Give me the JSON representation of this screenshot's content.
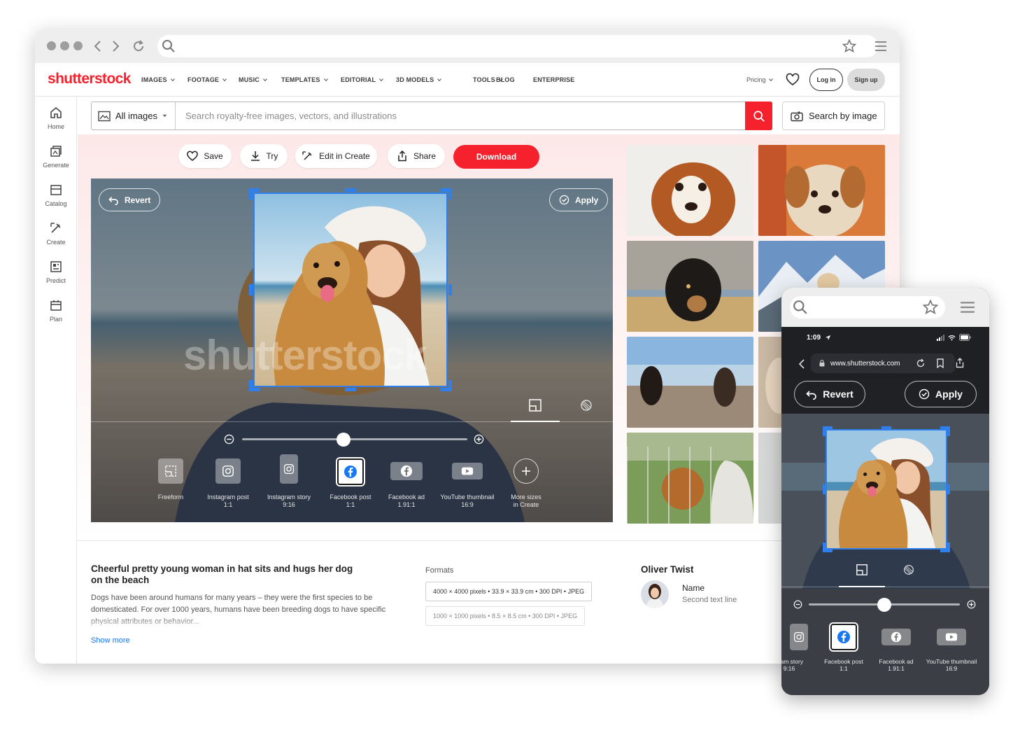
{
  "brand": {
    "logo": "shutterstock",
    "accent": "#f5222d",
    "selection": "#2f80ed"
  },
  "nav": {
    "items": [
      {
        "label": "IMAGES",
        "dropdown": true
      },
      {
        "label": "FOOTAGE",
        "dropdown": true
      },
      {
        "label": "MUSIC",
        "dropdown": true
      },
      {
        "label": "TEMPLATES",
        "dropdown": true
      },
      {
        "label": "EDITORIAL",
        "dropdown": true
      },
      {
        "label": "3D MODELS",
        "dropdown": true
      },
      {
        "label": "TOOLS",
        "dropdown": true
      },
      {
        "label": "BLOG",
        "dropdown": false
      },
      {
        "label": "ENTERPRISE",
        "dropdown": false
      }
    ],
    "pricing": "Pricing",
    "login": "Log in",
    "signup": "Sign up"
  },
  "sidebar": {
    "items": [
      {
        "label": "Home",
        "icon": "home-icon"
      },
      {
        "label": "Generate",
        "icon": "generate-icon"
      },
      {
        "label": "Catalog",
        "icon": "catalog-icon"
      },
      {
        "label": "Create",
        "icon": "create-icon"
      },
      {
        "label": "Predict",
        "icon": "predict-icon"
      },
      {
        "label": "Plan",
        "icon": "plan-icon"
      }
    ]
  },
  "search": {
    "category": "All images",
    "placeholder": "Search royalty-free images, vectors, and illustrations",
    "by_image": "Search by image"
  },
  "actions": {
    "save": "Save",
    "try": "Try",
    "edit": "Edit in Create",
    "share": "Share",
    "download": "Download"
  },
  "editor": {
    "revert": "Revert",
    "apply": "Apply",
    "watermark": "shutterstock",
    "zoom_level": 0.45,
    "presets": [
      {
        "name": "Freeform",
        "ratio": "",
        "icon": "freeform-icon"
      },
      {
        "name": "Instagram post",
        "ratio": "1:1",
        "icon": "instagram-icon"
      },
      {
        "name": "Instagram story",
        "ratio": "9:16",
        "icon": "instagram-icon"
      },
      {
        "name": "Facebook post",
        "ratio": "1:1",
        "icon": "facebook-icon",
        "selected": true
      },
      {
        "name": "Facebook ad",
        "ratio": "1.91:1",
        "icon": "facebook-icon"
      },
      {
        "name": "YouTube thumbnail",
        "ratio": "16:9",
        "icon": "youtube-icon"
      },
      {
        "name": "More sizes",
        "ratio": "in Create",
        "icon": "plus-icon"
      }
    ]
  },
  "details": {
    "title": "Cheerful pretty young woman in hat sits and hugs her dog on the beach",
    "description": "Dogs have been around humans for many years – they were the first species to be domesticated. For over 1000 years, humans have been breeding dogs to have specific physical attributes or behavior...",
    "show_more": "Show more",
    "formats_label": "Formats",
    "formats": [
      "4000 × 4000 pixels • 33.9 × 33.9 cm • 300 DPI • JPEG",
      "1000 × 1000 pixels • 8.5 × 8.5 cm • 300 DPI • JPEG"
    ],
    "author": "Oliver Twist",
    "author_name": "Name",
    "author_second": "Second text line"
  },
  "phone": {
    "time": "1:09",
    "url": "www.shutterstock.com",
    "revert": "Revert",
    "apply": "Apply",
    "zoom_level": 0.5,
    "presets": [
      {
        "name": "Instagram story",
        "visible_name": "gram story",
        "ratio": "9:16",
        "icon": "instagram-icon"
      },
      {
        "name": "Facebook post",
        "ratio": "1:1",
        "icon": "facebook-icon",
        "selected": true
      },
      {
        "name": "Facebook ad",
        "ratio": "1.91:1",
        "icon": "facebook-icon"
      },
      {
        "name": "YouTube thumbnail",
        "ratio": "16:9",
        "icon": "youtube-icon"
      }
    ]
  }
}
